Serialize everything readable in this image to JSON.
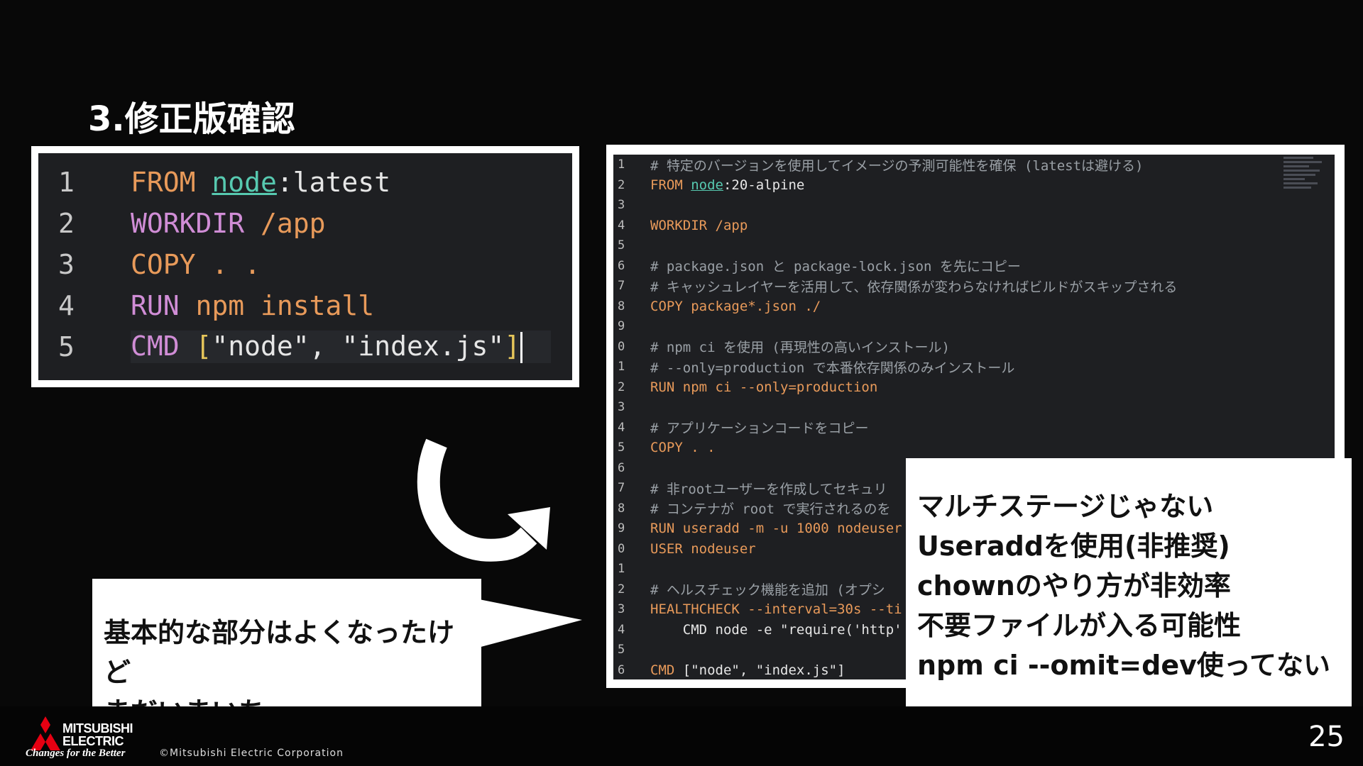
{
  "slide": {
    "title": "3.修正版確認",
    "page_number": "25"
  },
  "left_code": {
    "lines": [
      {
        "num": "1",
        "kw": "FROM",
        "ident": "node",
        "rest": ":latest"
      },
      {
        "num": "2",
        "kw": "WORKDIR",
        "rest": " /app"
      },
      {
        "num": "3",
        "kw": "COPY",
        "rest": " . ."
      },
      {
        "num": "4",
        "kw": "RUN",
        "rest": " npm install"
      },
      {
        "num": "5",
        "kw": "CMD",
        "s1": "\"node\"",
        "sep": ", ",
        "s2": "\"index.js\""
      }
    ]
  },
  "right_code": {
    "lines": [
      {
        "num": "1",
        "text": "# 特定のバージョンを使用してイメージの予測可能性を確保 (latestは避ける)"
      },
      {
        "num": "2",
        "kw": "FROM",
        "ident": "node",
        "rest": ":20-alpine"
      },
      {
        "num": "3",
        "text": ""
      },
      {
        "num": "4",
        "kw": "WORKDIR",
        "rest": " /app"
      },
      {
        "num": "5",
        "text": ""
      },
      {
        "num": "6",
        "text": "# package.json と package-lock.json を先にコピー"
      },
      {
        "num": "7",
        "text": "# キャッシュレイヤーを活用して、依存関係が変わらなければビルドがスキップされる"
      },
      {
        "num": "8",
        "kw": "COPY",
        "rest": " package*.json ./"
      },
      {
        "num": "9",
        "text": ""
      },
      {
        "num": "0",
        "text": "# npm ci を使用 (再現性の高いインストール)"
      },
      {
        "num": "1",
        "text": "# --only=production で本番依存関係のみインストール"
      },
      {
        "num": "2",
        "kw": "RUN",
        "rest": " npm ci --only=production"
      },
      {
        "num": "3",
        "text": ""
      },
      {
        "num": "4",
        "text": "# アプリケーションコードをコピー"
      },
      {
        "num": "5",
        "kw": "COPY",
        "rest": " . ."
      },
      {
        "num": "6",
        "text": ""
      },
      {
        "num": "7",
        "text": "# 非rootユーザーを作成してセキュリ"
      },
      {
        "num": "8",
        "text": "# コンテナが root で実行されるのを"
      },
      {
        "num": "9",
        "kw": "RUN",
        "rest": " useradd -m -u 1000 nodeuser"
      },
      {
        "num": "0",
        "kw": "USER",
        "rest": " nodeuser"
      },
      {
        "num": "1",
        "text": ""
      },
      {
        "num": "2",
        "text": "# ヘルスチェック機能を追加 (オプシ"
      },
      {
        "num": "3",
        "kw": "HEALTHCHECK",
        "rest": " --interval=30s --ti"
      },
      {
        "num": "4",
        "text": "    CMD node -e \"require('http'"
      },
      {
        "num": "5",
        "text": ""
      },
      {
        "num": "6",
        "kw": "CMD",
        "rest": " [\"node\", \"index.js\"]"
      }
    ]
  },
  "bubble": {
    "line1": "基本的な部分はよくなったけど",
    "line2": "まだいまいち…"
  },
  "note": {
    "lines": [
      "マルチステージじゃない",
      "Useraddを使用(非推奨)",
      "chownのやり方が非効率",
      "不要ファイルが入る可能性",
      "npm ci --omit=dev使ってない"
    ]
  },
  "footer": {
    "brand_line1": "MITSUBISHI",
    "brand_line2": "ELECTRIC",
    "tagline": "Changes for the Better",
    "copyright": "©Mitsubishi Electric Corporation"
  },
  "colors": {
    "keyword": "#e89a5a",
    "identifier": "#57c9b0",
    "comment": "#9aa0a6",
    "editor_bg": "#1e1f22",
    "brand_red": "#e60012"
  }
}
